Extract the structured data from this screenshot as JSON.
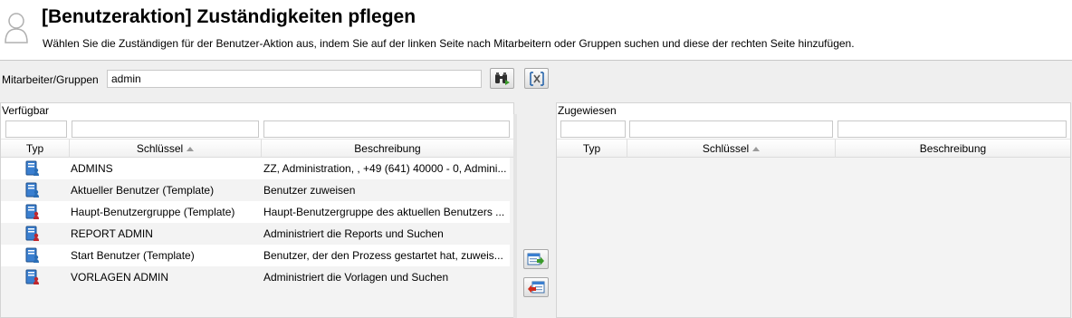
{
  "header": {
    "title": "[Benutzeraktion] Zuständigkeiten pflegen",
    "subtitle": "Wählen Sie die Zuständigen für der Benutzer-Aktion aus, indem Sie auf der linken Seite nach Mitarbeitern oder Gruppen suchen und diese der rechten Seite hinzufügen."
  },
  "search": {
    "label": "Mitarbeiter/Gruppen",
    "value": "admin",
    "search_icon": "binoculars-icon",
    "clear_icon": "clear-filter-icon"
  },
  "available": {
    "title": "Verfügbar",
    "columns": {
      "type": "Typ",
      "key": "Schlüssel",
      "description": "Beschreibung"
    },
    "sorted_column": "Schlüssel",
    "sort_direction": "ascending",
    "rows": [
      {
        "icon": "user-group-icon",
        "key": "ADMINS",
        "description": "ZZ, Administration, , +49 (641) 40000 - 0, Admini..."
      },
      {
        "icon": "user-group-icon",
        "key": "Aktueller Benutzer (Template)",
        "description": "Benutzer zuweisen"
      },
      {
        "icon": "role-group-icon",
        "key": "Haupt-Benutzergruppe (Template)",
        "description": "Haupt-Benutzergruppe des aktuellen Benutzers ..."
      },
      {
        "icon": "role-group-icon",
        "key": "REPORT ADMIN",
        "description": "Administriert die Reports und Suchen"
      },
      {
        "icon": "user-group-icon",
        "key": "Start Benutzer (Template)",
        "description": "Benutzer, der den Prozess gestartet hat, zuweis..."
      },
      {
        "icon": "role-group-icon",
        "key": "VORLAGEN ADMIN",
        "description": "Administriert die Vorlagen und Suchen"
      }
    ]
  },
  "assigned": {
    "title": "Zugewiesen",
    "columns": {
      "type": "Typ",
      "key": "Schlüssel",
      "description": "Beschreibung"
    },
    "rows": []
  },
  "transfer": {
    "add_icon": "move-right-icon",
    "remove_icon": "move-left-icon"
  },
  "colors": {
    "header_bg": "#ffffff",
    "page_bg": "#efefef",
    "row_alt": "#f3f3f3",
    "user_icon_blue": "#2a6db5",
    "role_icon_red": "#c0262c",
    "add_arrow": "#3a9a2a",
    "remove_arrow": "#d02a1a"
  }
}
